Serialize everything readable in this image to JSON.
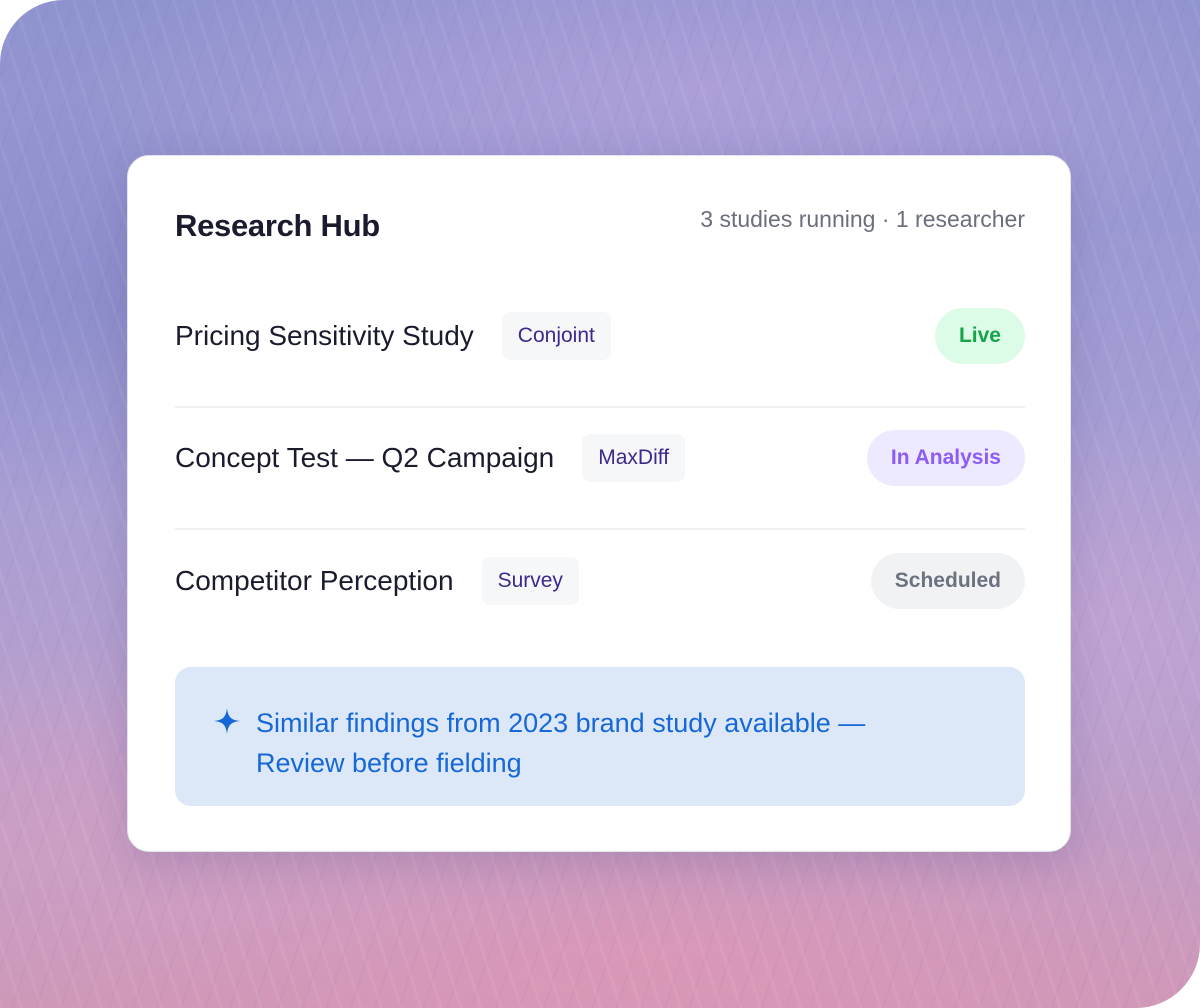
{
  "card": {
    "title": "Research Hub",
    "meta": "3 studies running · 1 researcher"
  },
  "studies": [
    {
      "name": "Pricing Sensitivity Study",
      "method": "Conjoint",
      "status": "Live",
      "status_color": "#16a34a"
    },
    {
      "name": "Concept Test — Q2 Campaign",
      "method": "MaxDiff",
      "status": "In Analysis",
      "status_color": "#8b5cf6"
    },
    {
      "name": "Competitor Perception",
      "method": "Survey",
      "status": "Scheduled",
      "status_color": "#6b7280"
    }
  ],
  "banner": {
    "icon": "sparkle-icon",
    "text": "Similar findings from 2023 brand study available — Review before fielding",
    "color": "#1568d6"
  }
}
